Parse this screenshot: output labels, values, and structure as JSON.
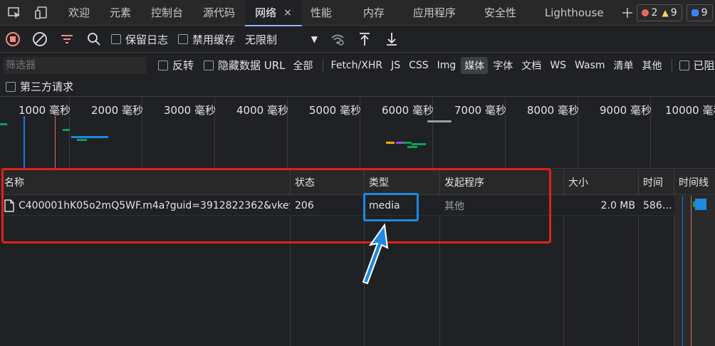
{
  "tabs": [
    {
      "label": "欢迎"
    },
    {
      "label": "元素"
    },
    {
      "label": "控制台"
    },
    {
      "label": "源代码"
    },
    {
      "label": "网络",
      "active": true
    },
    {
      "label": "性能"
    },
    {
      "label": "内存"
    },
    {
      "label": "应用程序"
    },
    {
      "label": "安全性"
    },
    {
      "label": "Lighthouse"
    }
  ],
  "tab_close": "×",
  "badges": {
    "errors": "2",
    "warnings": "9",
    "issues": "9"
  },
  "toolbar": {
    "preserve_log": "保留日志",
    "disable_cache": "禁用缓存",
    "throttle_value": "无限制"
  },
  "filter": {
    "placeholder": "筛选器",
    "invert": "反转",
    "hide_data_urls": "隐藏数据 URL",
    "types": [
      "全部",
      "Fetch/XHR",
      "JS",
      "CSS",
      "Img",
      "媒体",
      "字体",
      "文档",
      "WS",
      "Wasm",
      "清单",
      "其他"
    ],
    "active_type": "媒体",
    "blocked": "已阻"
  },
  "third_party": "第三方请求",
  "overview": {
    "ticks": [
      "1000 毫秒",
      "2000 毫秒",
      "3000 毫秒",
      "4000 毫秒",
      "5000 毫秒",
      "6000 毫秒",
      "7000 毫秒",
      "8000 毫秒",
      "9000 毫秒",
      "10000 毫秒"
    ]
  },
  "columns": {
    "name": "名称",
    "status": "状态",
    "type": "类型",
    "initiator": "发起程序",
    "size": "大小",
    "time": "时间",
    "waterfall": "时间线"
  },
  "rows": [
    {
      "name": "C400001hK05o2mQ5WF.m4a?guid=3912822362&vkey…",
      "status": "206",
      "type": "media",
      "initiator": "其他",
      "size": "2.0 MB",
      "time": "586…"
    }
  ],
  "colors": {
    "accent": "#8ab4f8",
    "highlight_red": "#e0211b",
    "highlight_blue": "#1e88e5"
  }
}
